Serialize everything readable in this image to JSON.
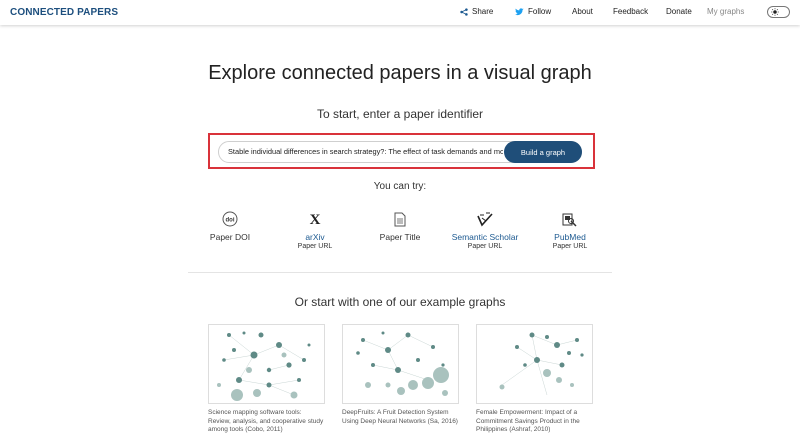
{
  "brand": "CONNECTED PAPERS",
  "nav": {
    "share": "Share",
    "follow": "Follow",
    "about": "About",
    "feedback": "Feedback",
    "donate": "Donate",
    "my_graphs": "My graphs"
  },
  "hero": {
    "title": "Explore connected papers in a visual graph",
    "subtitle": "To start, enter a paper identifier"
  },
  "search": {
    "value": "Stable individual differences in search strategy?: The effect of task demands and moti",
    "button": "Build a graph"
  },
  "try": {
    "title": "You can try:",
    "options": [
      {
        "label": "Paper DOI",
        "sub": "",
        "icon": "doi-icon"
      },
      {
        "label": "arXiv",
        "sub": "Paper URL",
        "icon": "arxiv-icon"
      },
      {
        "label": "Paper Title",
        "sub": "",
        "icon": "document-icon"
      },
      {
        "label": "Semantic Scholar",
        "sub": "Paper URL",
        "icon": "semantic-scholar-icon"
      },
      {
        "label": "PubMed",
        "sub": "Paper URL",
        "icon": "pubmed-icon"
      }
    ]
  },
  "examples": {
    "title": "Or start with one of our example graphs",
    "cards": [
      {
        "caption": "Science mapping software tools: Review, analysis, and cooperative study among tools (Cobo, 2011)"
      },
      {
        "caption": "DeepFruits: A Fruit Detection System Using Deep Neural Networks (Sa, 2016)"
      },
      {
        "caption": "Female Empowerment: Impact of a Commitment Savings Product in the Philippines (Ashraf, 2010)"
      }
    ]
  },
  "colors": {
    "brand": "#1d4f7e",
    "button": "#1f4e79",
    "highlight": "#d9323a",
    "link": "#1d5a91",
    "node": "#5f8a86"
  }
}
